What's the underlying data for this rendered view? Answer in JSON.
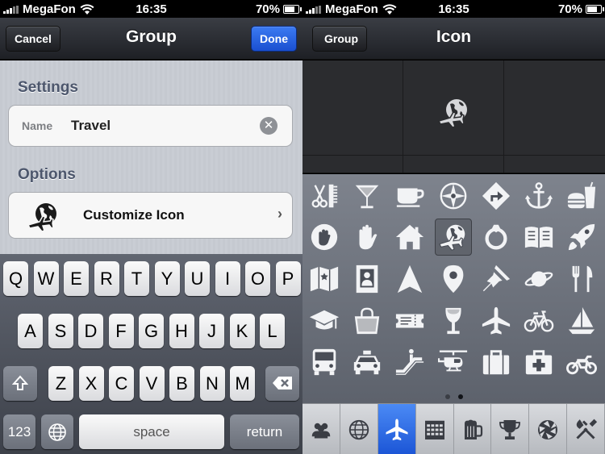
{
  "status": {
    "carrier": "MegaFon",
    "time": "16:35",
    "battery": "70%"
  },
  "left": {
    "nav": {
      "title": "Group",
      "cancel": "Cancel",
      "done": "Done"
    },
    "settings_header": "Settings",
    "name_label": "Name",
    "name_value": "Travel",
    "options_header": "Options",
    "customize_label": "Customize Icon",
    "keyboard": {
      "row1": [
        "Q",
        "W",
        "E",
        "R",
        "T",
        "Y",
        "U",
        "I",
        "O",
        "P"
      ],
      "row2": [
        "A",
        "S",
        "D",
        "F",
        "G",
        "H",
        "J",
        "K",
        "L"
      ],
      "row3": [
        "Z",
        "X",
        "C",
        "V",
        "B",
        "N",
        "M"
      ],
      "num_key": "123",
      "space": "space",
      "return": "return"
    }
  },
  "right": {
    "nav": {
      "title": "Icon",
      "back": "Group"
    },
    "icons": [
      [
        "scissors-comb-icon",
        "cocktail-icon",
        "coffee-cup-icon",
        "compass-icon",
        "direction-sign-icon",
        "anchor-icon",
        "fast-food-icon"
      ],
      [
        "stop-hand-icon",
        "hand-icon",
        "house-icon",
        "globe-plane-icon",
        "ring-icon",
        "book-icon",
        "rocket-icon"
      ],
      [
        "map-icon",
        "portrait-frame-icon",
        "navigation-arrow-icon",
        "map-pin-icon",
        "push-pin-icon",
        "planet-icon",
        "fork-knife-icon"
      ],
      [
        "graduation-cap-icon",
        "shopping-bag-icon",
        "ticket-icon",
        "wine-glass-icon",
        "airplane-icon",
        "bicycle-icon",
        "sailboat-icon"
      ],
      [
        "bus-icon",
        "taxi-icon",
        "escalator-icon",
        "helicopter-icon",
        "suitcase-icon",
        "first-aid-icon",
        "motorcycle-icon"
      ]
    ],
    "selected_icon": "globe-plane-icon",
    "tabs": [
      "people-icon",
      "globe-icon",
      "airplane-icon",
      "calendar-icon",
      "beer-icon",
      "trophy-icon",
      "aperture-icon",
      "tools-icon"
    ],
    "active_tab": 2,
    "page_count": 2,
    "current_page": 0
  },
  "colors": {
    "accent": "#1b55d6",
    "icon_fill": "#f2f3f5",
    "dot_active": "#111318",
    "dot_inactive": "#3a3d44"
  }
}
